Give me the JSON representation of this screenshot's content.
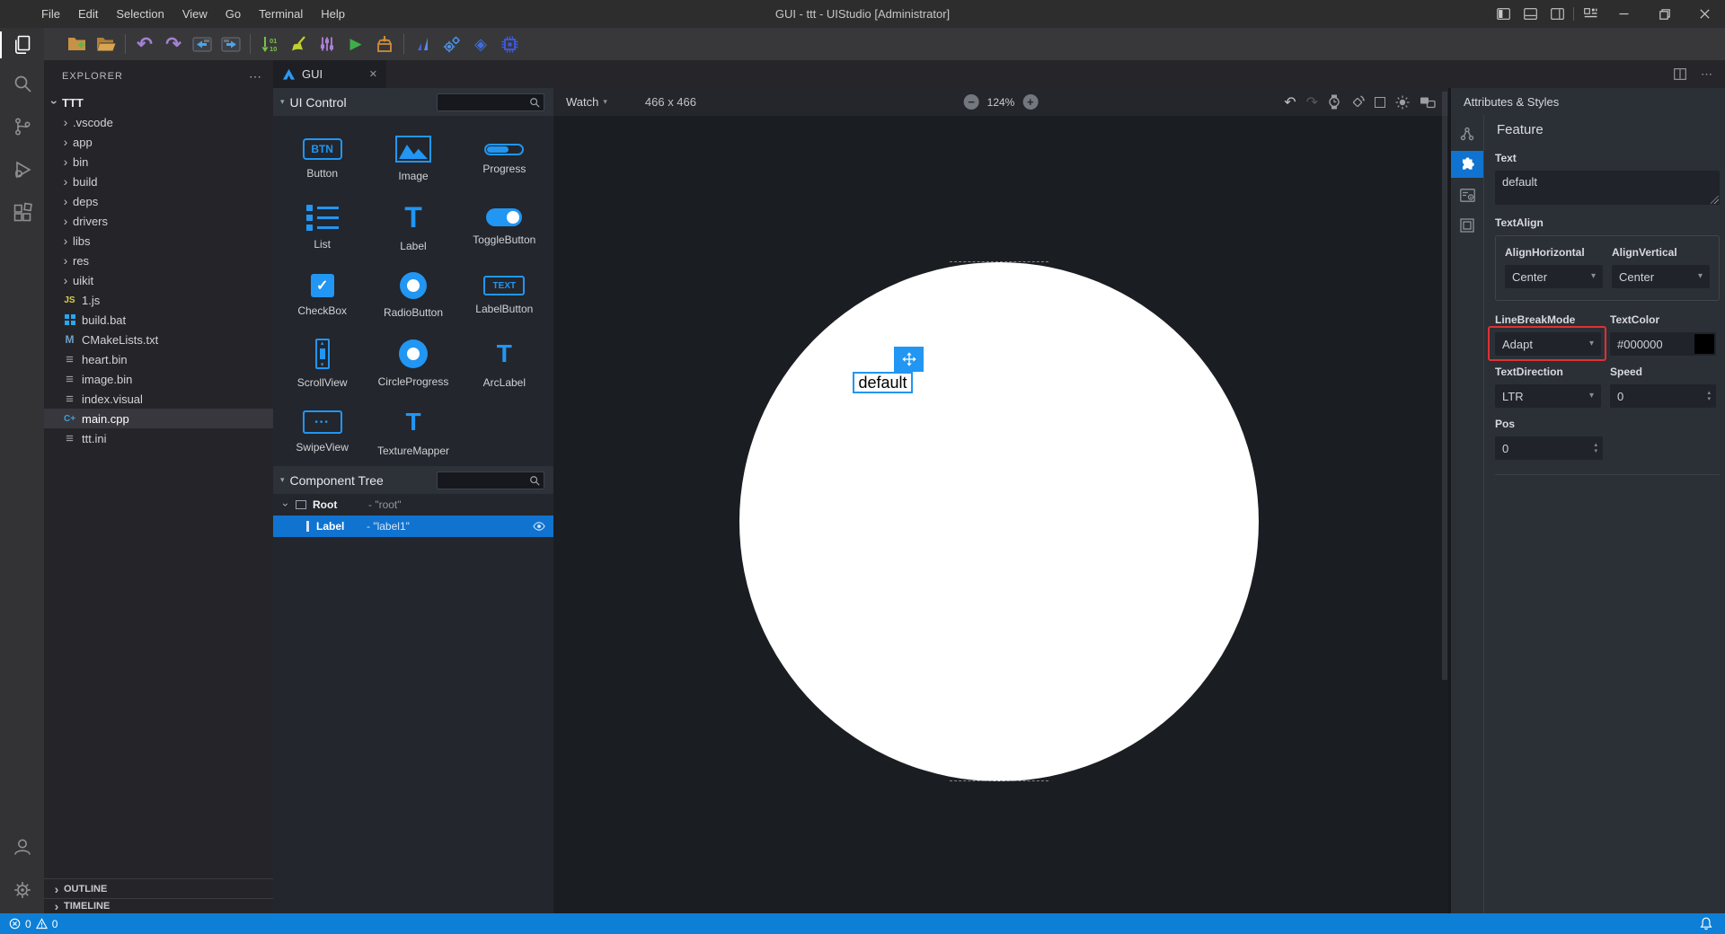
{
  "window": {
    "menus": [
      "File",
      "Edit",
      "Selection",
      "View",
      "Go",
      "Terminal",
      "Help"
    ],
    "title": "GUI - ttt - UIStudio [Administrator]"
  },
  "toolbar_icons": [
    "new-folder",
    "open-folder",
    "undo",
    "redo",
    "move-editor-left",
    "move-editor-right",
    "sort-lines",
    "clean",
    "tune",
    "run",
    "install",
    "chart",
    "build-gears",
    "shader-diamond",
    "chip"
  ],
  "activity_bar_icons": [
    "explorer",
    "search",
    "source-control",
    "run-debug",
    "extensions",
    "account",
    "settings"
  ],
  "explorer": {
    "header": "EXPLORER",
    "root": "TTT",
    "folders": [
      {
        "name": ".vscode"
      },
      {
        "name": "app"
      },
      {
        "name": "bin"
      },
      {
        "name": "build"
      },
      {
        "name": "deps"
      },
      {
        "name": "drivers"
      },
      {
        "name": "libs"
      },
      {
        "name": "res"
      },
      {
        "name": "uikit"
      }
    ],
    "files": [
      {
        "name": "1.js",
        "icon": "js"
      },
      {
        "name": "build.bat",
        "icon": "bat"
      },
      {
        "name": "CMakeLists.txt",
        "icon": "cmake"
      },
      {
        "name": "heart.bin",
        "icon": "bin"
      },
      {
        "name": "image.bin",
        "icon": "bin"
      },
      {
        "name": "index.visual",
        "icon": "bin"
      },
      {
        "name": "main.cpp",
        "icon": "cpp",
        "selected": true
      },
      {
        "name": "ttt.ini",
        "icon": "bin"
      }
    ],
    "outline": "OUTLINE",
    "timeline": "TIMELINE"
  },
  "editor": {
    "tab": "GUI"
  },
  "ui_control": {
    "title": "UI Control",
    "widgets": [
      {
        "label": "Button",
        "icon": "button"
      },
      {
        "label": "Image",
        "icon": "image"
      },
      {
        "label": "Progress",
        "icon": "progress"
      },
      {
        "label": "List",
        "icon": "list"
      },
      {
        "label": "Label",
        "icon": "label"
      },
      {
        "label": "ToggleButton",
        "icon": "toggle"
      },
      {
        "label": "CheckBox",
        "icon": "checkbox"
      },
      {
        "label": "RadioButton",
        "icon": "radio"
      },
      {
        "label": "LabelButton",
        "icon": "labelbutton"
      },
      {
        "label": "ScrollView",
        "icon": "scrollview"
      },
      {
        "label": "CircleProgress",
        "icon": "circleprogress"
      },
      {
        "label": "ArcLabel",
        "icon": "arclabel"
      },
      {
        "label": "SwipeView",
        "icon": "swipeview"
      },
      {
        "label": "TextureMapper",
        "icon": "texturemapper"
      }
    ]
  },
  "component_tree": {
    "title": "Component Tree",
    "root_type": "Root",
    "root_name": "- \"root\"",
    "child_type": "Label",
    "child_name": "- \"label1\""
  },
  "canvas": {
    "device": "Watch",
    "size": "466 x 466",
    "zoom": "124%",
    "label_text": "default"
  },
  "attributes": {
    "title": "Attributes & Styles",
    "section": "Feature",
    "text_label": "Text",
    "text_value": "default",
    "textalign_label": "TextAlign",
    "align_h_label": "AlignHorizontal",
    "align_h_value": "Center",
    "align_v_label": "AlignVertical",
    "align_v_value": "Center",
    "linebreak_label": "LineBreakMode",
    "linebreak_value": "Adapt",
    "textcolor_label": "TextColor",
    "textcolor_value": "#000000",
    "textdirection_label": "TextDirection",
    "textdirection_value": "LTR",
    "speed_label": "Speed",
    "speed_value": "0",
    "pos_label": "Pos",
    "pos_value": "0"
  },
  "status_bar": {
    "errors": "0",
    "warnings": "0"
  },
  "colors": {
    "accent_blue": "#1073d0",
    "widget_blue": "#2196f3",
    "highlight_red": "#e03131",
    "statusbar_blue": "#0e7fd6",
    "selected_textcolor": "#000000"
  }
}
